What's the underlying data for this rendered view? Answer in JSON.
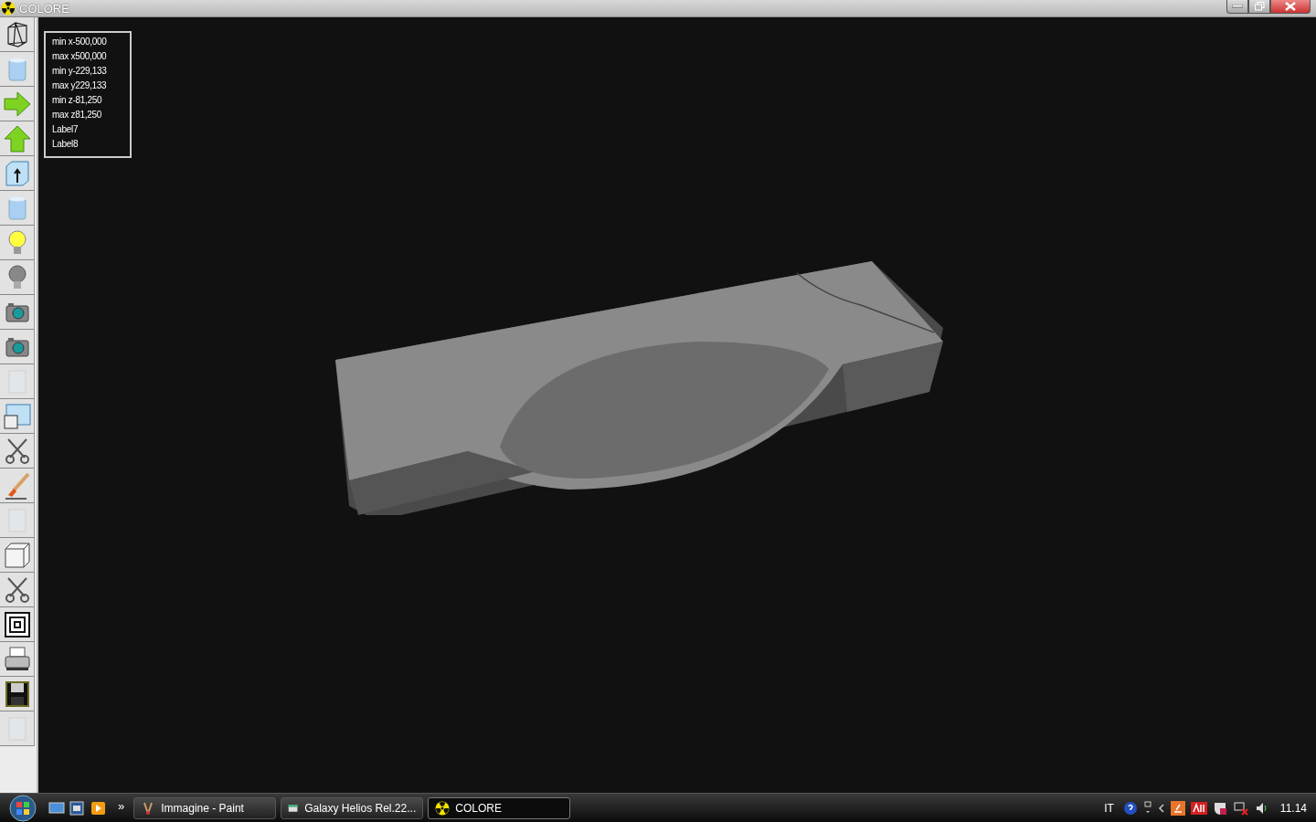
{
  "window": {
    "title": "COLORE"
  },
  "toolbar": [
    {
      "kind": "wireframe",
      "disabled": false
    },
    {
      "kind": "cylinder",
      "disabled": false
    },
    {
      "kind": "arrow-right",
      "disabled": false
    },
    {
      "kind": "arrow-up",
      "disabled": false
    },
    {
      "kind": "cube-arrow",
      "disabled": false
    },
    {
      "kind": "cylinder",
      "disabled": false
    },
    {
      "kind": "bulb-on",
      "disabled": false
    },
    {
      "kind": "bulb-off",
      "disabled": false
    },
    {
      "kind": "camera",
      "disabled": false
    },
    {
      "kind": "camera",
      "disabled": false
    },
    {
      "kind": "texture",
      "disabled": true
    },
    {
      "kind": "squares",
      "disabled": false
    },
    {
      "kind": "scissors",
      "disabled": false
    },
    {
      "kind": "brush",
      "disabled": false
    },
    {
      "kind": "texture",
      "disabled": true
    },
    {
      "kind": "cube",
      "disabled": false
    },
    {
      "kind": "scissors",
      "disabled": false
    },
    {
      "kind": "concentric",
      "disabled": false
    },
    {
      "kind": "printer",
      "disabled": false
    },
    {
      "kind": "floppy",
      "disabled": false
    },
    {
      "kind": "texture",
      "disabled": true
    }
  ],
  "info_panel": {
    "lines": [
      "min x-500,000",
      "max x500,000",
      "min y-229,133",
      "max y229,133",
      "min z-81,250",
      "max z81,250",
      "Label7",
      "Label8"
    ]
  },
  "taskbar": {
    "more": "»",
    "tasks": [
      {
        "label": "Immagine - Paint",
        "kind": "paint",
        "selected": false
      },
      {
        "label": "Galaxy Helios  Rel.22...",
        "kind": "app",
        "selected": false
      },
      {
        "label": "COLORE",
        "kind": "colore",
        "selected": true
      }
    ],
    "language": "IT",
    "clock": "11.14"
  }
}
